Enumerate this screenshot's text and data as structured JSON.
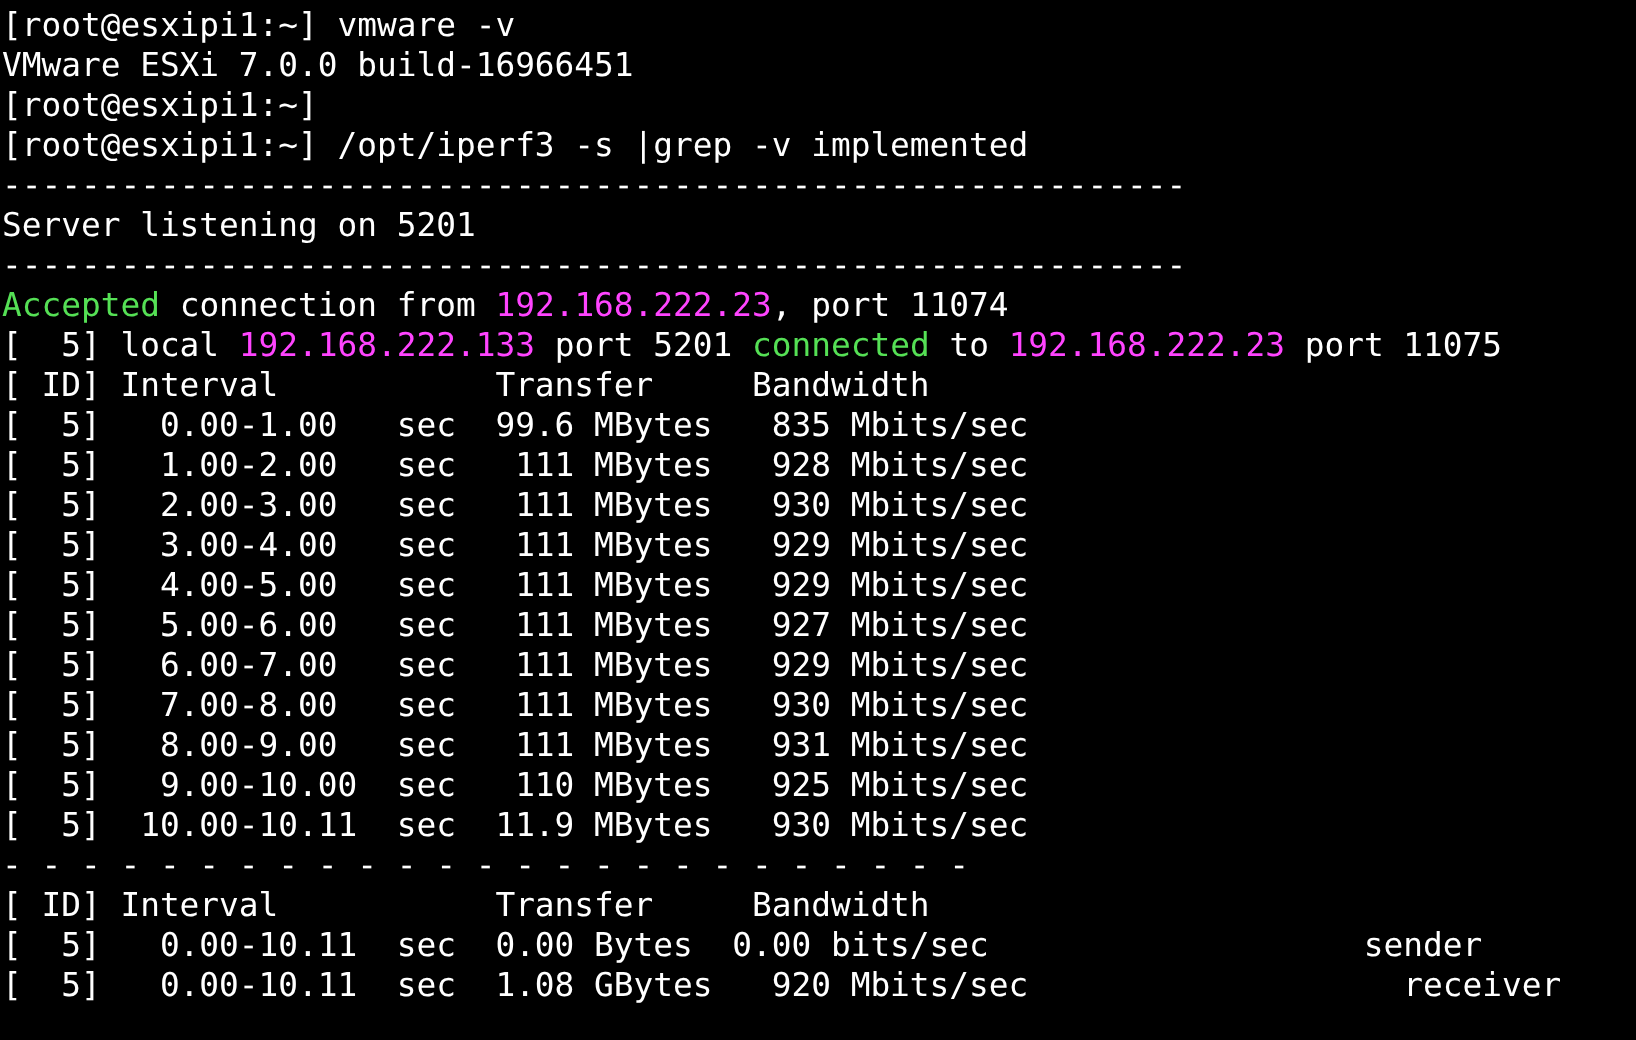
{
  "terminal": {
    "lines": [
      {
        "spans": [
          {
            "text": "[root@esxipi1:~] vmware -v",
            "kind": "text"
          }
        ]
      },
      {
        "spans": [
          {
            "text": "VMware ESXi 7.0.0 build-16966451",
            "kind": "text"
          }
        ]
      },
      {
        "spans": [
          {
            "text": "[root@esxipi1:~]",
            "kind": "text"
          }
        ]
      },
      {
        "spans": [
          {
            "text": "[root@esxipi1:~] /opt/iperf3 -s |grep -v implemented",
            "kind": "text"
          }
        ]
      },
      {
        "spans": [
          {
            "text": "------------------------------------------------------------",
            "kind": "text"
          }
        ]
      },
      {
        "spans": [
          {
            "text": "Server listening on 5201",
            "kind": "text"
          }
        ]
      },
      {
        "spans": [
          {
            "text": "------------------------------------------------------------",
            "kind": "text"
          }
        ]
      },
      {
        "spans": [
          {
            "text": "Accepted",
            "kind": "keyword"
          },
          {
            "text": " connection from ",
            "kind": "text"
          },
          {
            "text": "192.168.222.23",
            "kind": "address"
          },
          {
            "text": ", port 11074",
            "kind": "text"
          }
        ]
      },
      {
        "spans": [
          {
            "text": "[  5] local ",
            "kind": "text"
          },
          {
            "text": "192.168.222.133",
            "kind": "address"
          },
          {
            "text": " port 5201 ",
            "kind": "text"
          },
          {
            "text": "connected",
            "kind": "keyword"
          },
          {
            "text": " to ",
            "kind": "text"
          },
          {
            "text": "192.168.222.23",
            "kind": "address"
          },
          {
            "text": " port 11075",
            "kind": "text"
          }
        ]
      },
      {
        "spans": [
          {
            "text": "[ ID] Interval           Transfer     Bandwidth",
            "kind": "text"
          }
        ]
      },
      {
        "spans": [
          {
            "text": "[  5]   0.00-1.00   sec  99.6 MBytes   835 Mbits/sec",
            "kind": "text"
          }
        ]
      },
      {
        "spans": [
          {
            "text": "[  5]   1.00-2.00   sec   111 MBytes   928 Mbits/sec",
            "kind": "text"
          }
        ]
      },
      {
        "spans": [
          {
            "text": "[  5]   2.00-3.00   sec   111 MBytes   930 Mbits/sec",
            "kind": "text"
          }
        ]
      },
      {
        "spans": [
          {
            "text": "[  5]   3.00-4.00   sec   111 MBytes   929 Mbits/sec",
            "kind": "text"
          }
        ]
      },
      {
        "spans": [
          {
            "text": "[  5]   4.00-5.00   sec   111 MBytes   929 Mbits/sec",
            "kind": "text"
          }
        ]
      },
      {
        "spans": [
          {
            "text": "[  5]   5.00-6.00   sec   111 MBytes   927 Mbits/sec",
            "kind": "text"
          }
        ]
      },
      {
        "spans": [
          {
            "text": "[  5]   6.00-7.00   sec   111 MBytes   929 Mbits/sec",
            "kind": "text"
          }
        ]
      },
      {
        "spans": [
          {
            "text": "[  5]   7.00-8.00   sec   111 MBytes   930 Mbits/sec",
            "kind": "text"
          }
        ]
      },
      {
        "spans": [
          {
            "text": "[  5]   8.00-9.00   sec   111 MBytes   931 Mbits/sec",
            "kind": "text"
          }
        ]
      },
      {
        "spans": [
          {
            "text": "[  5]   9.00-10.00  sec   110 MBytes   925 Mbits/sec",
            "kind": "text"
          }
        ]
      },
      {
        "spans": [
          {
            "text": "[  5]  10.00-10.11  sec  11.9 MBytes   930 Mbits/sec",
            "kind": "text"
          }
        ]
      },
      {
        "spans": [
          {
            "text": "- - - - - - - - - - - - - - - - - - - - - - - - -",
            "kind": "text"
          }
        ]
      },
      {
        "spans": [
          {
            "text": "[ ID] Interval           Transfer     Bandwidth",
            "kind": "text"
          }
        ]
      },
      {
        "spans": [
          {
            "text": "[  5]   0.00-10.11  sec  0.00 Bytes  0.00 bits/sec                   sender",
            "kind": "text"
          }
        ]
      },
      {
        "spans": [
          {
            "text": "[  5]   0.00-10.11  sec  1.08 GBytes   920 Mbits/sec                   receiver",
            "kind": "text"
          }
        ]
      }
    ]
  }
}
